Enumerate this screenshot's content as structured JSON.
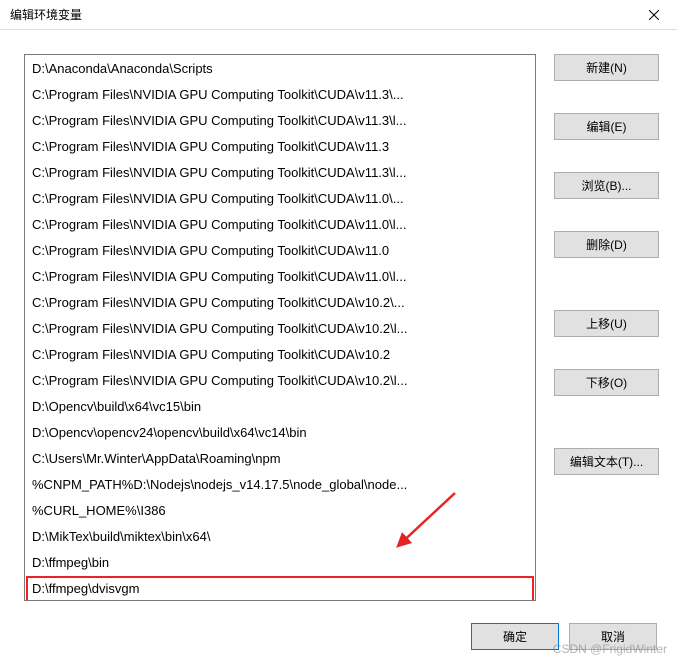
{
  "window": {
    "title": "编辑环境变量"
  },
  "paths": [
    "D:\\Anaconda\\Anaconda\\Scripts",
    "C:\\Program Files\\NVIDIA GPU Computing Toolkit\\CUDA\\v11.3\\...",
    "C:\\Program Files\\NVIDIA GPU Computing Toolkit\\CUDA\\v11.3\\l...",
    "C:\\Program Files\\NVIDIA GPU Computing Toolkit\\CUDA\\v11.3",
    "C:\\Program Files\\NVIDIA GPU Computing Toolkit\\CUDA\\v11.3\\l...",
    "C:\\Program Files\\NVIDIA GPU Computing Toolkit\\CUDA\\v11.0\\...",
    "C:\\Program Files\\NVIDIA GPU Computing Toolkit\\CUDA\\v11.0\\l...",
    "C:\\Program Files\\NVIDIA GPU Computing Toolkit\\CUDA\\v11.0",
    "C:\\Program Files\\NVIDIA GPU Computing Toolkit\\CUDA\\v11.0\\l...",
    "C:\\Program Files\\NVIDIA GPU Computing Toolkit\\CUDA\\v10.2\\...",
    "C:\\Program Files\\NVIDIA GPU Computing Toolkit\\CUDA\\v10.2\\l...",
    "C:\\Program Files\\NVIDIA GPU Computing Toolkit\\CUDA\\v10.2",
    "C:\\Program Files\\NVIDIA GPU Computing Toolkit\\CUDA\\v10.2\\l...",
    "D:\\Opencv\\build\\x64\\vc15\\bin",
    "D:\\Opencv\\opencv24\\opencv\\build\\x64\\vc14\\bin",
    "C:\\Users\\Mr.Winter\\AppData\\Roaming\\npm",
    "%CNPM_PATH%D:\\Nodejs\\nodejs_v14.17.5\\node_global\\node...",
    "%CURL_HOME%\\I386",
    "D:\\MikTex\\build\\miktex\\bin\\x64\\",
    "D:\\ffmpeg\\bin",
    "D:\\ffmpeg\\dvisvgm"
  ],
  "selected_index": 20,
  "buttons": {
    "new": "新建(N)",
    "edit": "编辑(E)",
    "browse": "浏览(B)...",
    "delete": "删除(D)",
    "moveup": "上移(U)",
    "movedown": "下移(O)",
    "edittext": "编辑文本(T)...",
    "ok": "确定",
    "cancel": "取消"
  },
  "watermark": "CSDN @FrigidWinter"
}
